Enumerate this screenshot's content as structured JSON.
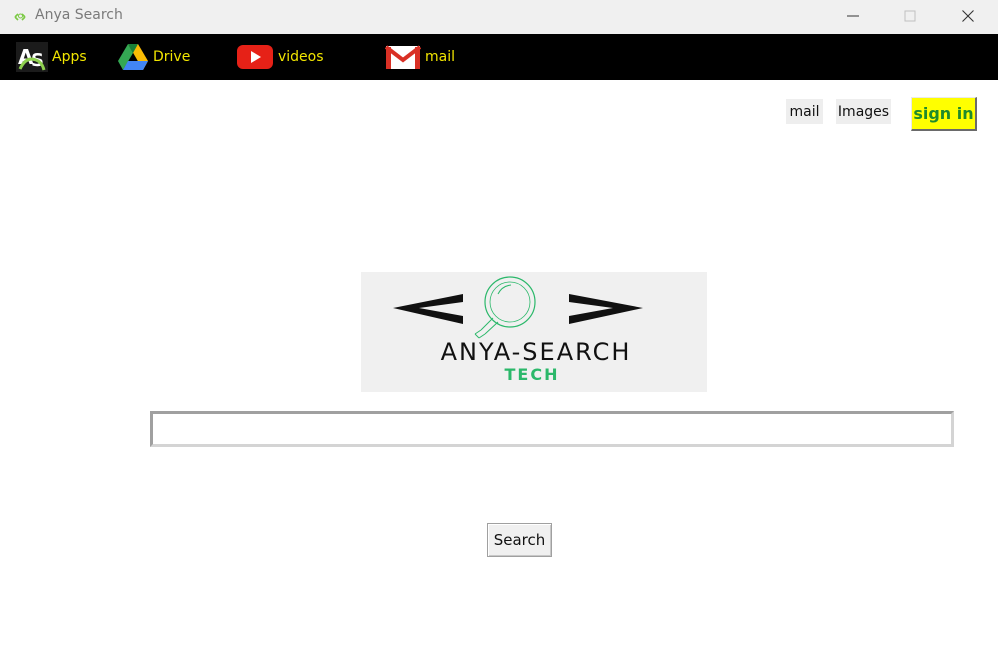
{
  "window": {
    "title": "Anya Search",
    "icon": "anya-logo-icon"
  },
  "toolbar": {
    "items": [
      {
        "label": "Apps",
        "icon": "apps-logo-icon"
      },
      {
        "label": "Drive",
        "icon": "google-drive-icon"
      },
      {
        "label": "videos",
        "icon": "youtube-icon"
      },
      {
        "label": "mail",
        "icon": "gmail-icon"
      }
    ],
    "label_color": "#f2e600",
    "background": "#000000"
  },
  "header_links": {
    "mail": "mail",
    "images": "Images",
    "sign_in": "sign in",
    "sign_in_bg": "#ffff00",
    "sign_in_color": "#1f8a2c"
  },
  "logo": {
    "brand": "ANYA-SEARCH",
    "sub": "TECH",
    "sub_color": "#2bb86a",
    "icon": "magnifier-icon"
  },
  "search": {
    "value": "",
    "placeholder": "",
    "button_label": "Search"
  }
}
